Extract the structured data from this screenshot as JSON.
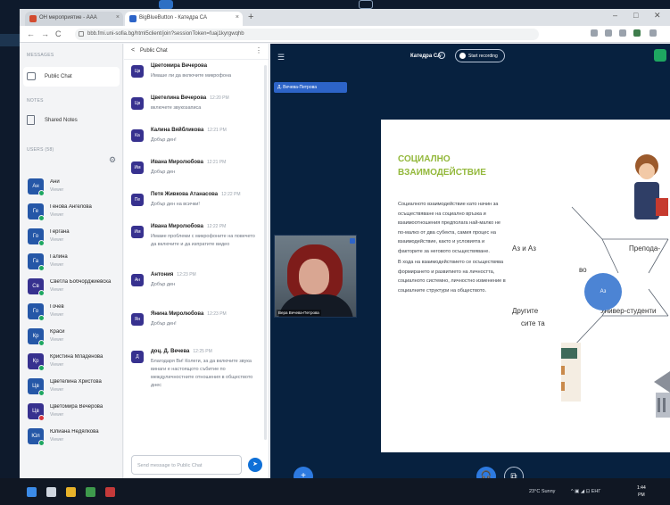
{
  "browser": {
    "tabs": [
      {
        "label": "ОН мероприятие - ААА"
      },
      {
        "label": "BigBlueButton - Катедра СА"
      }
    ],
    "url": "bbb.fmi.uni-sofia.bg/html5client/join?sessionToken=fuaj1kyrgwqhb",
    "controls": {
      "back": "←",
      "forward": "→",
      "reload": "C",
      "minimize": "–",
      "maximize": "□",
      "close": "✕",
      "new_tab": "+",
      "tab_close": "×"
    }
  },
  "users_panel": {
    "messages_header": "MESSAGES",
    "public_chat": "Public Chat",
    "notes_header": "NOTES",
    "shared_notes": "Shared Notes",
    "users_header": "USERS (58)",
    "users": [
      {
        "initials": "Ан",
        "name": "Ани",
        "sub": "Viewer",
        "status": "green"
      },
      {
        "initials": "Ге",
        "name": "Генова Ангелова",
        "sub": "Viewer",
        "status": "green"
      },
      {
        "initials": "Го",
        "name": "Гергана",
        "sub": "Viewer",
        "status": "green"
      },
      {
        "initials": "Га",
        "name": "Галина",
        "sub": "Viewer",
        "status": "green"
      },
      {
        "initials": "Св",
        "name": "Светла Бобчорджиевска",
        "sub": "Viewer",
        "status": "green"
      },
      {
        "initials": "Го",
        "name": "Гочев",
        "sub": "Viewer",
        "status": "green"
      },
      {
        "initials": "Кр",
        "name": "Краси",
        "sub": "Viewer",
        "status": "green"
      },
      {
        "initials": "Кр",
        "name": "Кристина Младенова",
        "sub": "Viewer",
        "status": "green"
      },
      {
        "initials": "Цв",
        "name": "Цветелина Христова",
        "sub": "Viewer",
        "status": "green"
      },
      {
        "initials": "Цв",
        "name": "Цветомира Вечерова",
        "sub": "Viewer",
        "status": "red"
      },
      {
        "initials": "Юл",
        "name": "Юлиана Недялкова",
        "sub": "Viewer",
        "status": "green"
      }
    ]
  },
  "chat": {
    "title": "Public Chat",
    "back_icon": "<",
    "dots_icon": "⋮",
    "messages": [
      {
        "initials": "Цв",
        "name": "Цветомира Вечерова",
        "time": "",
        "text": "Имаше ли да включите микрофона"
      },
      {
        "initials": "Цв",
        "name": "Цветелина Вечерова",
        "time": "12:20 PM",
        "text": "включете звукозаписа"
      },
      {
        "initials": "Ка",
        "name": "Калина Вяйбликова",
        "time": "12:21 PM",
        "text": "Добър ден!"
      },
      {
        "initials": "Им",
        "name": "Ивана Миролюбова",
        "time": "12:21 PM",
        "text": "Добър ден"
      },
      {
        "initials": "Пе",
        "name": "Петя Живкова Атанасова",
        "time": "12:22 PM",
        "text": "Добър ден на всички!"
      },
      {
        "initials": "Им",
        "name": "Ивана Миролюбова",
        "time": "12:22 PM",
        "text": "Имаме проблеми с микрофоните на повечето да включите и да изпратите видео"
      },
      {
        "initials": "Ан",
        "name": "Антония",
        "time": "12:23 PM",
        "text": "Добър ден"
      },
      {
        "initials": "Ян",
        "name": "Янина Миролюбова",
        "time": "12:23 PM",
        "text": "Добър ден!"
      },
      {
        "initials": "Д",
        "name": "доц. Д. Вечева",
        "time": "12:25 PM",
        "text": "Благодаря Ви! Колеги, за да включите звука винаги е настоящото събитие по междуличностните отношения в обществото днес"
      }
    ],
    "input_placeholder": "Send message to Public Chat",
    "send_icon": "➤"
  },
  "meeting": {
    "menu_icon": "☰",
    "title": "Катедра СА",
    "info_icon": "i",
    "record_label": "Start recording",
    "presenter_label": "Д. Вечева-Петрова",
    "camera_label": "Вера Вечева-Петрова",
    "slide": {
      "heading": "СОЦИАЛНО ВЗАИМОДЕЙСТВИЕ",
      "body_1": "Социалното взаимодействие като начин за осъществяване на социално връзка и взаимоотношения предполага най-малко не по-малко от два субекта, самия процес на взаимодействие, както и условията и факторите за неговото осъществяване.",
      "body_2": "В хода на взаимодействието се осъществява формирането и развитието на личността, социалното системно, личностно изменение в социалните структури на обществото.",
      "label_a": "Аз и Аз",
      "label_b": "Препода-",
      "label_c": "Другите",
      "label_d": "сите та",
      "label_e": "Универ-студенти",
      "label_f": "во",
      "hub": "Аз"
    },
    "add_icon": "+",
    "audio_icon": "🎧",
    "screen_icon": "⧉",
    "exit_icon": "✕"
  },
  "taskbar": {
    "weather": "23°C Sunny",
    "tray_icons": "^ ▣ ◢ ⊡ ЕНГ",
    "time": "1:44",
    "date": "PM"
  },
  "colors": {
    "meeting_bg": "#07213f",
    "accent_blue": "#2d7ae0",
    "chat_avatar": "#37318f",
    "slide_heading": "#93b83b",
    "online": "#1ea761",
    "offline": "#d9363e"
  }
}
